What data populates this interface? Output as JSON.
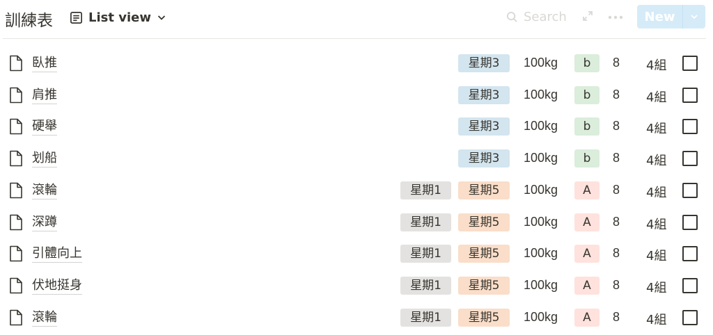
{
  "header": {
    "title": "訓練表",
    "view_label": "List view",
    "search_label": "Search",
    "new_label": "New"
  },
  "colors": {
    "blue_tag": "#d3e5ef",
    "gray_tag": "#e3e2e0",
    "orange_tag": "#fadec9",
    "green_tag": "#dbeddb",
    "red_tag": "#ffe2dd",
    "new_button": "#d6ebf8"
  },
  "rows": [
    {
      "name": "臥推",
      "day_tags": [
        {
          "label": "星期3",
          "color": "blue"
        }
      ],
      "weight": "100kg",
      "grade": "b",
      "grade_color": "green",
      "reps": "8",
      "sets": "4組",
      "checked": false
    },
    {
      "name": "肩推",
      "day_tags": [
        {
          "label": "星期3",
          "color": "blue"
        }
      ],
      "weight": "100kg",
      "grade": "b",
      "grade_color": "green",
      "reps": "8",
      "sets": "4組",
      "checked": false
    },
    {
      "name": "硬舉",
      "day_tags": [
        {
          "label": "星期3",
          "color": "blue"
        }
      ],
      "weight": "100kg",
      "grade": "b",
      "grade_color": "green",
      "reps": "8",
      "sets": "4組",
      "checked": false
    },
    {
      "name": "划船",
      "day_tags": [
        {
          "label": "星期3",
          "color": "blue"
        }
      ],
      "weight": "100kg",
      "grade": "b",
      "grade_color": "green",
      "reps": "8",
      "sets": "4組",
      "checked": false
    },
    {
      "name": "滾輪",
      "day_tags": [
        {
          "label": "星期1",
          "color": "gray"
        },
        {
          "label": "星期5",
          "color": "orange"
        }
      ],
      "weight": "100kg",
      "grade": "A",
      "grade_color": "red",
      "reps": "8",
      "sets": "4組",
      "checked": false
    },
    {
      "name": "深蹲",
      "day_tags": [
        {
          "label": "星期1",
          "color": "gray"
        },
        {
          "label": "星期5",
          "color": "orange"
        }
      ],
      "weight": "100kg",
      "grade": "A",
      "grade_color": "red",
      "reps": "8",
      "sets": "4組",
      "checked": false
    },
    {
      "name": "引體向上",
      "day_tags": [
        {
          "label": "星期1",
          "color": "gray"
        },
        {
          "label": "星期5",
          "color": "orange"
        }
      ],
      "weight": "100kg",
      "grade": "A",
      "grade_color": "red",
      "reps": "8",
      "sets": "4組",
      "checked": false
    },
    {
      "name": "伏地挺身",
      "day_tags": [
        {
          "label": "星期1",
          "color": "gray"
        },
        {
          "label": "星期5",
          "color": "orange"
        }
      ],
      "weight": "100kg",
      "grade": "A",
      "grade_color": "red",
      "reps": "8",
      "sets": "4組",
      "checked": false
    },
    {
      "name": "滾輪",
      "day_tags": [
        {
          "label": "星期1",
          "color": "gray"
        },
        {
          "label": "星期5",
          "color": "orange"
        }
      ],
      "weight": "100kg",
      "grade": "A",
      "grade_color": "red",
      "reps": "8",
      "sets": "4組",
      "checked": false
    }
  ]
}
